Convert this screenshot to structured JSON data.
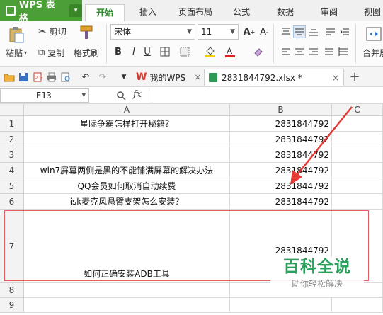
{
  "app": {
    "title": "WPS 表格",
    "dropdown": "▾"
  },
  "tabs": [
    {
      "label": "开始",
      "active": true
    },
    {
      "label": "插入"
    },
    {
      "label": "页面布局"
    },
    {
      "label": "公式"
    },
    {
      "label": "数据"
    },
    {
      "label": "审阅"
    },
    {
      "label": "视图"
    }
  ],
  "ribbon": {
    "paste": "粘贴",
    "cut": "剪切",
    "copy": "复制",
    "format_painter": "格式刷",
    "font_name": "宋体",
    "font_size": "11",
    "bold": "B",
    "italic": "I",
    "underline": "U",
    "merge": "合并居"
  },
  "doc_tabs": [
    {
      "label": "我的WPS"
    },
    {
      "label": "2831844792.xlsx *"
    }
  ],
  "formula_bar": {
    "cell_ref": "E13",
    "fx": "fx"
  },
  "columns": [
    "A",
    "B",
    "C"
  ],
  "rows": [
    {
      "num": "1",
      "a": "星际争霸怎样打开秘籍？",
      "b": "2831844792"
    },
    {
      "num": "2",
      "a": "",
      "b": "2831844792"
    },
    {
      "num": "3",
      "a": "",
      "b": "2831844792"
    },
    {
      "num": "4",
      "a": "win7屏幕两侧是黑的不能铺满屏幕的解决办法",
      "b": "2831844792"
    },
    {
      "num": "5",
      "a": "QQ会员如何取消自动续费",
      "b": "2831844792"
    },
    {
      "num": "6",
      "a": "isk麦克风悬臂支架怎么安装？",
      "b": "2831844792"
    },
    {
      "num": "7",
      "a": "如何正确安装ADB工具",
      "b": "2831844792"
    },
    {
      "num": "8",
      "a": "",
      "b": ""
    },
    {
      "num": "9",
      "a": "",
      "b": ""
    }
  ],
  "watermark": {
    "title": "百科全说",
    "subtitle": "助你轻松解决"
  },
  "colors": {
    "brand": "#4c9f38",
    "active_tab": "#2b8a2b",
    "annotation": "#e53935",
    "watermark": "#2aa05c"
  }
}
